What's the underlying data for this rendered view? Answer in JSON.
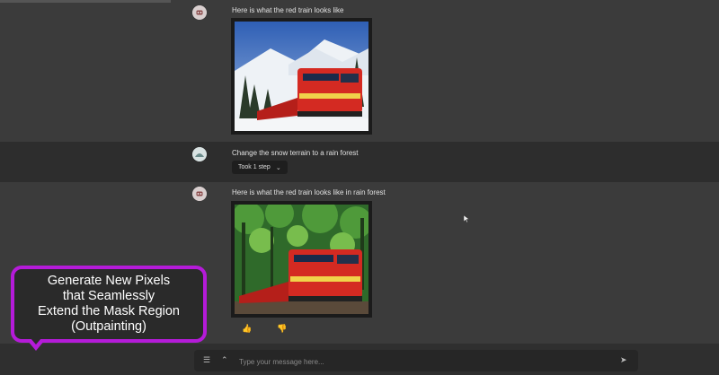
{
  "messages": [
    {
      "role": "assistant",
      "text": "Here is what the red train looks like",
      "image": "red-train-snow"
    },
    {
      "role": "user",
      "text": "Change the snow terrain to a rain forest",
      "steps_label": "Took 1 step"
    },
    {
      "role": "assistant",
      "text": "Here is what the red train looks like in rain forest",
      "image": "red-train-rainforest"
    }
  ],
  "feedback": {
    "like_icon": "thumbs-up-icon",
    "dislike_icon": "thumbs-down-icon"
  },
  "input": {
    "placeholder": "Type your message here..."
  },
  "callout": {
    "lines": [
      "Generate New Pixels",
      "that Seamlessly",
      "Extend the Mask Region",
      "(Outpainting)"
    ]
  },
  "colors": {
    "callout_border": "#b51bd9",
    "train_red": "#d42a22",
    "background": "#3a3a3a"
  }
}
